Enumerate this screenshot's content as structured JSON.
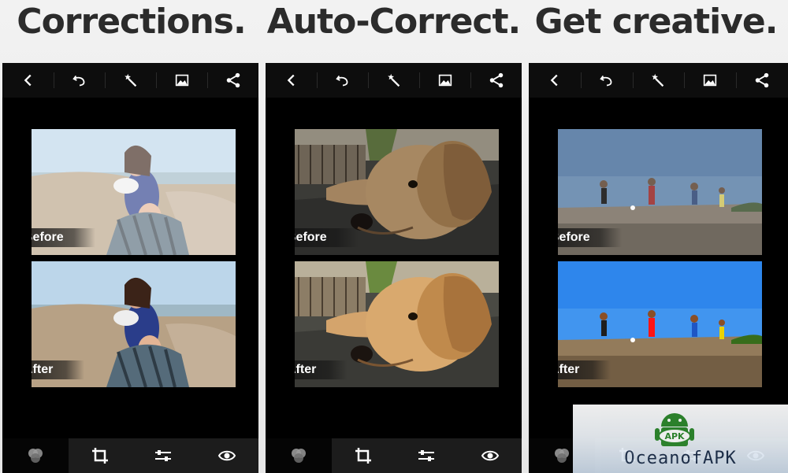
{
  "headings": [
    "Corrections.",
    "Auto-Correct.",
    "Get creative."
  ],
  "toolbar_icons": [
    "back-icon",
    "undo-icon",
    "magic-wand-icon",
    "image-icon",
    "share-icon"
  ],
  "bottom_icons": [
    "looks-icon",
    "crop-icon",
    "adjust-sliders-icon",
    "eye-icon"
  ],
  "panels": [
    {
      "before_label": "Before",
      "after_label": "After",
      "photo": "beach-couple-photo"
    },
    {
      "before_label": "Before",
      "after_label": "After",
      "photo": "dog-photo"
    },
    {
      "before_label": "Before",
      "after_label": "After",
      "photo": "kids-playing-photo"
    }
  ],
  "watermark": {
    "text": "OceanofAPK",
    "logo_text": "APK"
  },
  "colors": {
    "accent": "#ffffff",
    "background": "#000000"
  }
}
